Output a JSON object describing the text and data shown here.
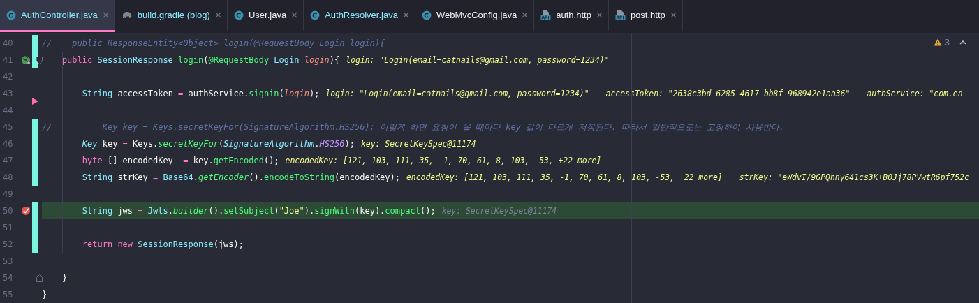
{
  "tabs": [
    {
      "label": "AuthController.java",
      "kind": "class",
      "selected": true,
      "modified": true
    },
    {
      "label": "build.gradle (blog)",
      "kind": "gradle",
      "selected": false,
      "modified": true
    },
    {
      "label": "User.java",
      "kind": "class",
      "selected": false,
      "modified": false
    },
    {
      "label": "AuthResolver.java",
      "kind": "class",
      "selected": false,
      "modified": true
    },
    {
      "label": "WebMvcConfig.java",
      "kind": "class",
      "selected": false,
      "modified": false
    },
    {
      "label": "auth.http",
      "kind": "http",
      "selected": false,
      "modified": false
    },
    {
      "label": "post.http",
      "kind": "http",
      "selected": false,
      "modified": false
    }
  ],
  "problems": {
    "warnings": "3"
  },
  "editor": {
    "lines": [
      {
        "number": "40",
        "changed": true,
        "deleted": false,
        "current": false,
        "tokens": [
          {
            "kind": "comment",
            "text": "//    public ResponseEntity<Object> login(@RequestBody Login login){"
          }
        ]
      },
      {
        "number": "41",
        "changed": true,
        "deleted": false,
        "current": false,
        "gutter": {
          "kind": "endpoint"
        },
        "fold_marker": {
          "kind": "start"
        },
        "tokens": [
          {
            "kind": "kw",
            "text": "    public"
          },
          {
            "kind": "type",
            "text": " SessionResponse"
          },
          {
            "kind": "fn",
            "text": " login"
          },
          {
            "kind": "plain",
            "text": "("
          },
          {
            "kind": "ann",
            "text": "@RequestBody"
          },
          {
            "kind": "type",
            "text": " Login"
          },
          {
            "kind": "param",
            "text": " login"
          },
          {
            "kind": "plain",
            "text": "){"
          }
        ],
        "hints": [
          {
            "text": "login: \"Login(email=catnails@gmail.com, password=1234)\"",
            "kind": "value"
          }
        ]
      },
      {
        "number": "42",
        "changed": false,
        "deleted": false,
        "current": false
      },
      {
        "number": "43",
        "changed": false,
        "deleted": false,
        "current": false,
        "tokens": [
          {
            "kind": "type",
            "text": "        String"
          },
          {
            "kind": "plain",
            "text": " accessToken "
          },
          {
            "kind": "op",
            "text": "="
          },
          {
            "kind": "plain",
            "text": " authService."
          },
          {
            "kind": "fn",
            "text": "signin"
          },
          {
            "kind": "plain",
            "text": "("
          },
          {
            "kind": "param",
            "text": "login"
          },
          {
            "kind": "plain",
            "text": ");"
          }
        ],
        "hints": [
          {
            "text": "login: \"Login(email=catnails@gmail.com, password=1234)\"",
            "kind": "value"
          },
          {
            "text": "accessToken: \"2638c3bd-6285-4617-bb8f-968942e1aa36\"",
            "kind": "value"
          },
          {
            "text": "authService: \"com.en",
            "kind": "value"
          }
        ]
      },
      {
        "number": "44",
        "changed": false,
        "deleted": true,
        "current": false
      },
      {
        "number": "45",
        "changed": true,
        "deleted": false,
        "current": false,
        "tokens": [
          {
            "kind": "comment",
            "text": "//          Key key = Keys.secretKeyFor(SignatureAlgorithm.HS256); 이렇게 하면 요청이 올 때마다 key 값이 다르게 저장된다. 따라서 일반적으로는 고정하여 사용한다."
          }
        ]
      },
      {
        "number": "46",
        "changed": true,
        "deleted": false,
        "current": false,
        "tokens": [
          {
            "kind": "typei",
            "text": "        Key"
          },
          {
            "kind": "plain",
            "text": " key "
          },
          {
            "kind": "op",
            "text": "="
          },
          {
            "kind": "plain",
            "text": " Keys."
          },
          {
            "kind": "fni",
            "text": "secretKeyFor"
          },
          {
            "kind": "plain",
            "text": "("
          },
          {
            "kind": "typei",
            "text": "SignatureAlgorithm"
          },
          {
            "kind": "plain",
            "text": "."
          },
          {
            "kind": "const",
            "text": "HS256"
          },
          {
            "kind": "plain",
            "text": ");"
          }
        ],
        "hints": [
          {
            "text": "key: SecretKeySpec@11174",
            "kind": "value"
          }
        ]
      },
      {
        "number": "47",
        "changed": true,
        "deleted": false,
        "current": false,
        "tokens": [
          {
            "kind": "kw",
            "text": "        byte"
          },
          {
            "kind": "plain",
            "text": " [] encodedKey  "
          },
          {
            "kind": "op",
            "text": "="
          },
          {
            "kind": "plain",
            "text": " key."
          },
          {
            "kind": "fn",
            "text": "getEncoded"
          },
          {
            "kind": "plain",
            "text": "();"
          }
        ],
        "hints": [
          {
            "text": "encodedKey: [121, 103, 111, 35, -1, 70, 61, 8, 103, -53, +22 more]",
            "kind": "value"
          }
        ]
      },
      {
        "number": "48",
        "changed": true,
        "deleted": false,
        "current": false,
        "tokens": [
          {
            "kind": "type",
            "text": "        String"
          },
          {
            "kind": "plain",
            "text": " strKey "
          },
          {
            "kind": "op",
            "text": "="
          },
          {
            "kind": "type",
            "text": " Base64"
          },
          {
            "kind": "plain",
            "text": "."
          },
          {
            "kind": "fni",
            "text": "getEncoder"
          },
          {
            "kind": "plain",
            "text": "()."
          },
          {
            "kind": "fn",
            "text": "encodeToString"
          },
          {
            "kind": "plain",
            "text": "(encodedKey);"
          }
        ],
        "hints": [
          {
            "text": "encodedKey: [121, 103, 111, 35, -1, 70, 61, 8, 103, -53, +22 more]",
            "kind": "value"
          },
          {
            "text": "strKey: \"eWdvI/9GPQhny641cs3K+B0Jj78PVwtR6pf752c",
            "kind": "value"
          }
        ]
      },
      {
        "number": "49",
        "changed": false,
        "deleted": false,
        "current": false
      },
      {
        "number": "50",
        "changed": true,
        "deleted": false,
        "current": true,
        "gutter": {
          "kind": "breakpoint"
        },
        "tokens": [
          {
            "kind": "type",
            "text": "        String"
          },
          {
            "kind": "plain",
            "text": " jws "
          },
          {
            "kind": "op",
            "text": "="
          },
          {
            "kind": "type",
            "text": " Jwts"
          },
          {
            "kind": "plain",
            "text": "."
          },
          {
            "kind": "fni",
            "text": "builder"
          },
          {
            "kind": "plain",
            "text": "()."
          },
          {
            "kind": "fn",
            "text": "setSubject"
          },
          {
            "kind": "plain",
            "text": "("
          },
          {
            "kind": "str",
            "text": "\"Joe\""
          },
          {
            "kind": "plain",
            "text": ")."
          },
          {
            "kind": "fn",
            "text": "signWith"
          },
          {
            "kind": "plain",
            "text": "(key)."
          },
          {
            "kind": "fn",
            "text": "compact"
          },
          {
            "kind": "plain",
            "text": "();"
          }
        ],
        "hints": [
          {
            "text": "key: SecretKeySpec@11174",
            "kind": "muted"
          }
        ]
      },
      {
        "number": "51",
        "changed": true,
        "deleted": false,
        "current": false
      },
      {
        "number": "52",
        "changed": true,
        "deleted": false,
        "current": false,
        "tokens": [
          {
            "kind": "kw",
            "text": "        return"
          },
          {
            "kind": "kw",
            "text": " new"
          },
          {
            "kind": "type",
            "text": " SessionResponse"
          },
          {
            "kind": "plain",
            "text": "(jws);"
          }
        ]
      },
      {
        "number": "53",
        "changed": false,
        "deleted": false,
        "current": false
      },
      {
        "number": "54",
        "changed": false,
        "deleted": false,
        "current": false,
        "fold_marker": {
          "kind": "end"
        },
        "tokens": [
          {
            "kind": "plain",
            "text": "    }"
          }
        ]
      },
      {
        "number": "55",
        "changed": false,
        "deleted": false,
        "current": false,
        "tokens": [
          {
            "kind": "plain",
            "text": "}"
          }
        ]
      }
    ]
  }
}
